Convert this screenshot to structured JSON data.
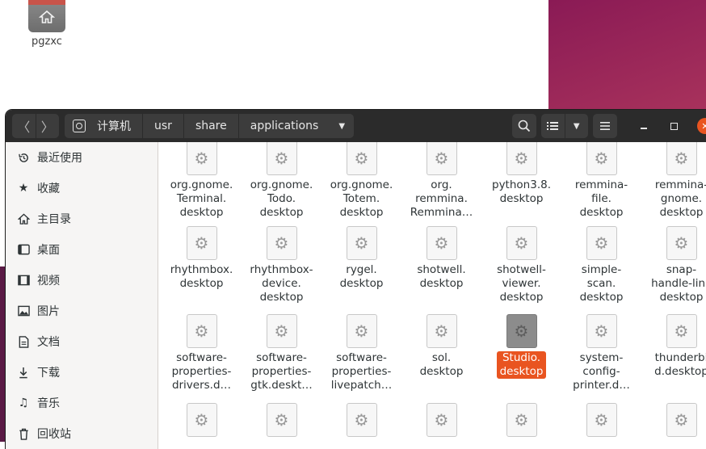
{
  "desktop": {
    "home_label": "pgzxc"
  },
  "headerbar": {
    "back_icon": "chevron-left-icon",
    "forward_icon": "chevron-right-icon",
    "breadcrumbs": [
      "计算机",
      "usr",
      "share",
      "applications"
    ],
    "colors": {
      "bar": "#2b2b2b",
      "button": "#3c3c3c",
      "close": "#e95420"
    }
  },
  "sidebar": {
    "items": [
      {
        "label": "最近使用",
        "icon": "recent-clock-icon"
      },
      {
        "label": "收藏",
        "icon": "star-icon"
      },
      {
        "label": "主目录",
        "icon": "home-icon"
      },
      {
        "label": "桌面",
        "icon": "desktop-icon"
      },
      {
        "label": "视频",
        "icon": "video-icon"
      },
      {
        "label": "图片",
        "icon": "picture-icon"
      },
      {
        "label": "文档",
        "icon": "document-icon"
      },
      {
        "label": "下载",
        "icon": "download-icon"
      },
      {
        "label": "音乐",
        "icon": "music-icon"
      },
      {
        "label": "回收站",
        "icon": "trash-icon"
      }
    ]
  },
  "files": {
    "row1": [
      "org.gnome.\nTerminal.\ndesktop",
      "org.gnome.\nTodo.\ndesktop",
      "org.gnome.\nTotem.\ndesktop",
      "org.\nremmina.\nRemmina…",
      "python3.8.\ndesktop",
      "remmina-\nfile.\ndesktop",
      "remmina-\ngnome.\ndesktop"
    ],
    "row2": [
      "rhythmbox.\ndesktop",
      "rhythmbox-\ndevice.\ndesktop",
      "rygel.\ndesktop",
      "shotwell.\ndesktop",
      "shotwell-\nviewer.\ndesktop",
      "simple-\nscan.\ndesktop",
      "snap-\nhandle-link\ndesktop"
    ],
    "row3": [
      "software-\nproperties-\ndrivers.d…",
      "software-\nproperties-\ngtk.deskt…",
      "software-\nproperties-\nlivepatch…",
      "sol.\ndesktop",
      "Studio.\ndesktop",
      "system-\nconfig-\nprinter.d…",
      "thunderbi\nd.desktop"
    ],
    "selected_color": "#e95420"
  }
}
